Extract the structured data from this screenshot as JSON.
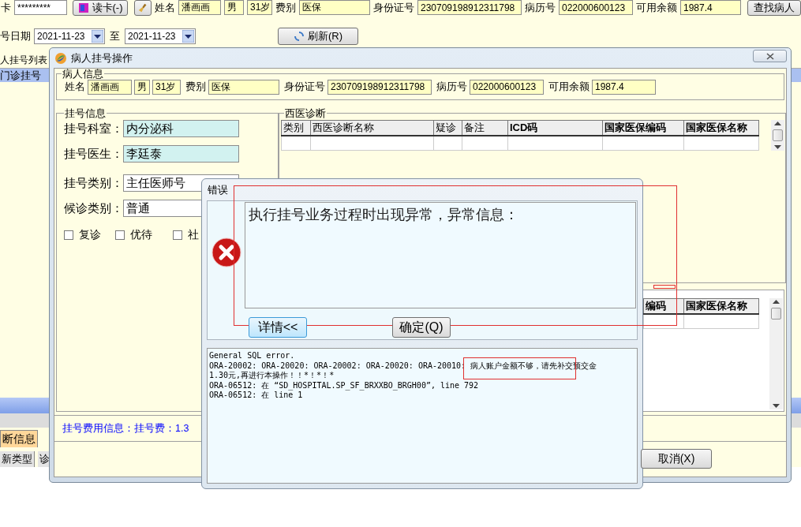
{
  "app": {
    "top_bar": {
      "card_label": "卡",
      "card_value": "*********",
      "read_card_button": "读卡(-)",
      "fields": [
        {
          "kind": "name",
          "label": "姓名",
          "value": "潘画画"
        },
        {
          "kind": "sex",
          "value": "男"
        },
        {
          "kind": "age",
          "value": "31岁"
        },
        {
          "kind": "fee",
          "label": "费别",
          "value": "医保"
        },
        {
          "kind": "id",
          "label": "身份证号",
          "value": "230709198912311798"
        },
        {
          "kind": "record",
          "label": "病历号",
          "value": "022000600123"
        },
        {
          "kind": "balance",
          "label": "可用余额",
          "value": "1987.4"
        }
      ],
      "find_button": "查找病人"
    },
    "date_bar": {
      "label": "号日期",
      "from": "2021-11-23",
      "to_label": "至",
      "to": "2021-11-23",
      "refresh_button": "刷新(R)"
    },
    "list_title": "人挂号列表",
    "list_row": "门诊挂号",
    "bottom_tab": {
      "label": "断信息",
      "selected": true
    },
    "bottom_columns": [
      "新类型",
      "诊"
    ]
  },
  "dialog": {
    "title": "病人挂号操作",
    "patient_group": {
      "title": "病人信息",
      "fields": [
        {
          "kind": "name",
          "label": "姓名",
          "value": "潘画画"
        },
        {
          "kind": "sex",
          "value": "男"
        },
        {
          "kind": "age",
          "value": "31岁"
        },
        {
          "kind": "fee",
          "label": "费别",
          "value": "医保"
        },
        {
          "kind": "id",
          "label": "身份证号",
          "value": "230709198912311798"
        },
        {
          "kind": "record",
          "label": "病历号",
          "value": "022000600123"
        },
        {
          "kind": "balance",
          "label": "可用余额",
          "value": "1987.4"
        }
      ]
    },
    "register_group": {
      "title": "挂号信息",
      "fields": [
        {
          "kind": "lookup",
          "label": "挂号科室：",
          "value": "内分泌科"
        },
        {
          "kind": "lookup",
          "label": "挂号医生：",
          "value": "李廷泰"
        },
        {
          "kind": "select",
          "label": "挂号类别：",
          "value": "主任医师号"
        },
        {
          "kind": "select",
          "label": "候诊类别：",
          "value": "普通"
        }
      ],
      "options": [
        {
          "label": "复诊",
          "checked": false
        },
        {
          "label": "优待",
          "checked": false
        },
        {
          "label": "社",
          "checked": false
        }
      ]
    },
    "diagnosis_group": {
      "title": "西医诊断",
      "columns": [
        {
          "label": "类别",
          "bold": false
        },
        {
          "label": "西医诊断名称",
          "bold": false
        },
        {
          "label": "疑诊",
          "bold": false
        },
        {
          "label": "备注",
          "bold": false
        },
        {
          "label": "ICD码",
          "bold": true
        },
        {
          "label": "国家医保编码",
          "bold": true
        },
        {
          "label": "国家医保名称",
          "bold": true
        }
      ]
    },
    "second_table": {
      "columns": [
        {
          "label": "编码",
          "bold": true
        },
        {
          "label": "国家医保名称",
          "bold": true
        }
      ]
    },
    "fee_info": "挂号费用信息：挂号费：1.3",
    "cancel_button": "取消(X)"
  },
  "error_dialog": {
    "title": "错误",
    "message": "执行挂号业务过程时出现异常，异常信息：",
    "details_button": "详情<<",
    "ok_button": "确定(Q)",
    "detail_lines": [
      "General SQL error.",
      "ORA-20002: ORA-20020: ORA-20002: ORA-20020: ORA-20010: 病人账户金额不够，请先补交预交金",
      "1.30元,再进行本操作！！*！*！*",
      "ORA-06512: 在 “SD_HOSPITAL.SP_SF_BRXXBO_BRGH00”, line 792",
      "ORA-06512: 在 line 1"
    ]
  }
}
